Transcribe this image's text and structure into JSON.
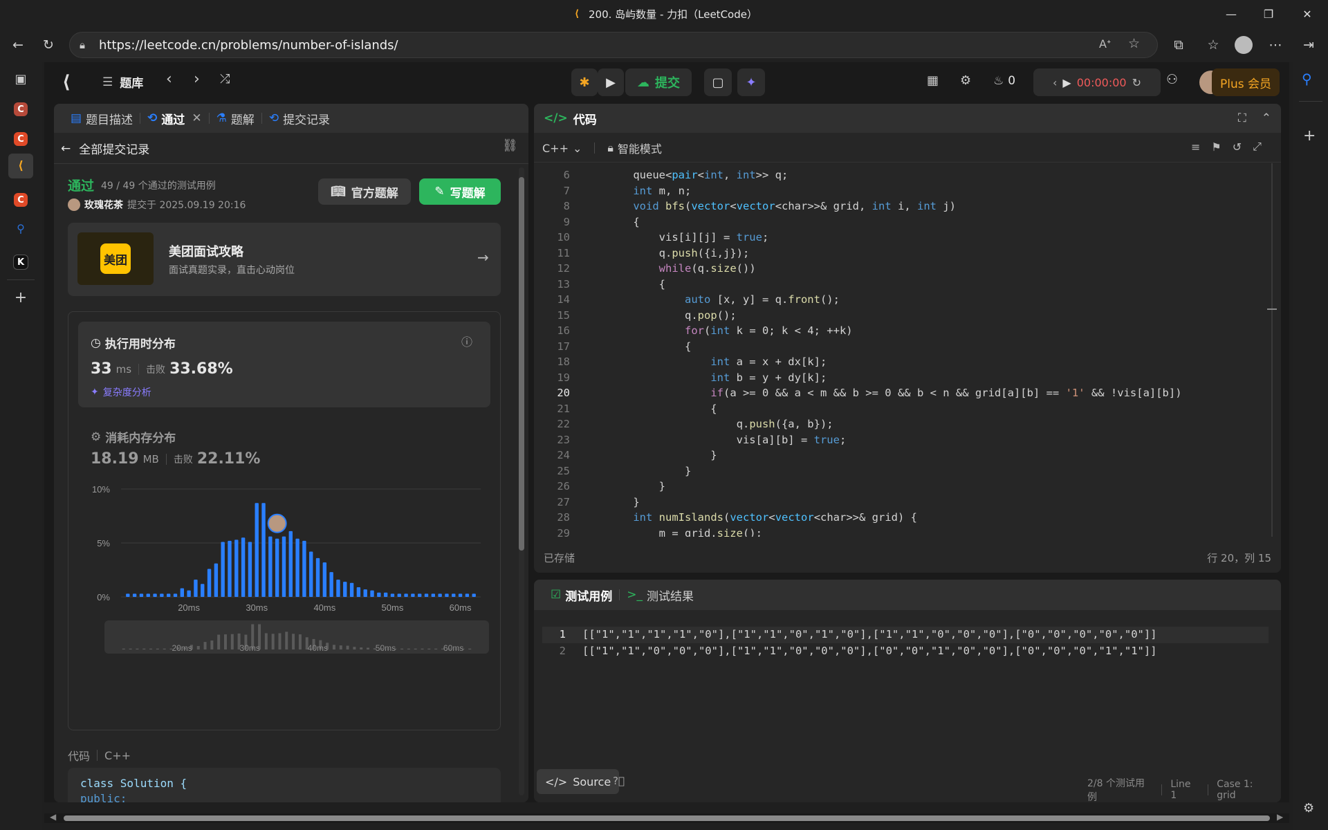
{
  "browser": {
    "title": "200. 岛屿数量 - 力扣（LeetCode）",
    "url": "https://leetcode.cn/problems/number-of-islands/"
  },
  "nav": {
    "library": "题库",
    "submit": "提交",
    "streak": "0",
    "timer": "00:00:00",
    "plus": "Plus 会员"
  },
  "left": {
    "tabs": [
      "题目描述",
      "通过",
      "题解",
      "提交记录"
    ],
    "back_label": "全部提交记录",
    "status": "通过",
    "testcases_passed": "49 / 49 个通过的测试用例",
    "user": "玫瑰花茶",
    "submitted_at": "提交于 2025.09.19 20:16",
    "official_solution": "官方题解",
    "write_solution": "写题解",
    "promo_logo": "美团",
    "promo_title": "美团面试攻略",
    "promo_sub": "面试真题实录，直击心动岗位",
    "runtime_title": "执行用时分布",
    "runtime_value": "33",
    "runtime_unit": "ms",
    "beats_label": "击败",
    "runtime_beats": "33.68%",
    "complexity": "复杂度分析",
    "memory_title": "消耗内存分布",
    "memory_value": "18.19",
    "memory_unit": "MB",
    "memory_beats": "22.11%",
    "code_label": "代码",
    "code_lang": "C++",
    "code_preview": [
      "class Solution {",
      "public:"
    ]
  },
  "chart_data": {
    "type": "bar",
    "ylabel": "",
    "xlabel": "",
    "y_ticks": [
      "10%",
      "5%",
      "0%"
    ],
    "x_ticks": [
      "20ms",
      "30ms",
      "40ms",
      "50ms",
      "60ms"
    ],
    "ylim": [
      0,
      10
    ],
    "xlim": [
      10,
      63
    ],
    "x": [
      11,
      12,
      13,
      14,
      15,
      16,
      17,
      18,
      19,
      20,
      21,
      22,
      23,
      24,
      25,
      26,
      27,
      28,
      29,
      30,
      31,
      32,
      33,
      34,
      35,
      36,
      37,
      38,
      39,
      40,
      41,
      42,
      43,
      44,
      45,
      46,
      47,
      48,
      49,
      50,
      51,
      52,
      53,
      54,
      55,
      56,
      57,
      58,
      59,
      60,
      61,
      62
    ],
    "values": [
      0.3,
      0.3,
      0.3,
      0.3,
      0.3,
      0.3,
      0.3,
      0.3,
      0.8,
      0.6,
      1.6,
      1.2,
      2.6,
      3.1,
      5.1,
      5.2,
      5.3,
      5.5,
      5.1,
      8.7,
      8.7,
      5.6,
      5.4,
      5.6,
      6.1,
      5.4,
      5.2,
      4.2,
      3.6,
      3.2,
      2.3,
      1.6,
      1.4,
      1.3,
      0.9,
      0.7,
      0.6,
      0.4,
      0.4,
      0.3,
      0.3,
      0.3,
      0.3,
      0.3,
      0.3,
      0.3,
      0.3,
      0.3,
      0.3,
      0.3,
      0.3,
      0.3
    ],
    "highlight_x": 33
  },
  "editor": {
    "title": "代码",
    "lang": "C++",
    "mode": "智能模式",
    "saved": "已存储",
    "cursor": "行 20，列 15",
    "lines": [
      {
        "n": "6",
        "t": "    queue<pair<int, int>> q;"
      },
      {
        "n": "7",
        "t": "    int m, n;"
      },
      {
        "n": "8",
        "t": "    void bfs(vector<vector<char>>& grid, int i, int j)"
      },
      {
        "n": "9",
        "t": "    {"
      },
      {
        "n": "10",
        "t": "        vis[i][j] = true;"
      },
      {
        "n": "11",
        "t": "        q.push({i,j});"
      },
      {
        "n": "12",
        "t": "        while(q.size())"
      },
      {
        "n": "13",
        "t": "        {"
      },
      {
        "n": "14",
        "t": "            auto [x, y] = q.front();"
      },
      {
        "n": "15",
        "t": "            q.pop();"
      },
      {
        "n": "16",
        "t": "            for(int k = 0; k < 4; ++k)"
      },
      {
        "n": "17",
        "t": "            {"
      },
      {
        "n": "18",
        "t": "                int a = x + dx[k];"
      },
      {
        "n": "19",
        "t": "                int b = y + dy[k];"
      },
      {
        "n": "20",
        "t": "                if(a >= 0 && a < m && b >= 0 && b < n && grid[a][b] == '1' && !vis[a][b])"
      },
      {
        "n": "21",
        "t": "                {"
      },
      {
        "n": "22",
        "t": "                    q.push({a, b});"
      },
      {
        "n": "23",
        "t": "                    vis[a][b] = true;"
      },
      {
        "n": "24",
        "t": "                }"
      },
      {
        "n": "25",
        "t": "            }"
      },
      {
        "n": "26",
        "t": "        }"
      },
      {
        "n": "27",
        "t": "    }"
      },
      {
        "n": "28",
        "t": "    int numIslands(vector<vector<char>>& grid) {"
      },
      {
        "n": "29",
        "t": "        m = grid.size();"
      }
    ]
  },
  "testcase": {
    "tab1": "测试用例",
    "tab2": "测试结果",
    "lines": [
      {
        "n": "1",
        "t": "[[\"1\",\"1\",\"1\",\"1\",\"0\"],[\"1\",\"1\",\"0\",\"1\",\"0\"],[\"1\",\"1\",\"0\",\"0\",\"0\"],[\"0\",\"0\",\"0\",\"0\",\"0\"]]"
      },
      {
        "n": "2",
        "t": "[[\"1\",\"1\",\"0\",\"0\",\"0\"],[\"1\",\"1\",\"0\",\"0\",\"0\"],[\"0\",\"0\",\"1\",\"0\",\"0\"],[\"0\",\"0\",\"0\",\"1\",\"1\"]]"
      }
    ],
    "source": "Source",
    "stat_cases": "2/8 个测试用例",
    "stat_line": "Line 1",
    "stat_case": "Case 1: grid"
  },
  "colors": {
    "accent_green": "#2db55d",
    "blue_bar": "#2a7fff",
    "orange": "#f5a623"
  }
}
